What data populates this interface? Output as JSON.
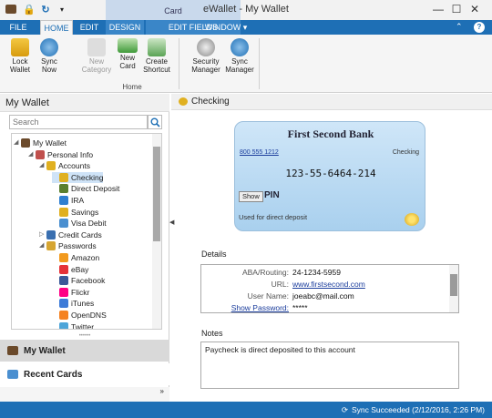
{
  "window": {
    "title": "eWallet - My Wallet",
    "context_group": "Card"
  },
  "ribbon": {
    "tabs": [
      "FILE",
      "HOME",
      "EDIT",
      "DESIGN",
      "EDIT FIELDS",
      "WINDOW"
    ],
    "home_group": "Home",
    "buttons": [
      {
        "label": "Lock Wallet",
        "icon": "lock-icon"
      },
      {
        "label": "Sync Now",
        "icon": "sync-icon"
      },
      {
        "label": "New Category",
        "icon": "folder-icon"
      },
      {
        "label": "New Card",
        "icon": "card-icon"
      },
      {
        "label": "Create Shortcut",
        "icon": "shortcut-icon"
      },
      {
        "label": "Security Manager",
        "icon": "security-icon"
      },
      {
        "label": "Sync Manager",
        "icon": "sync-manager-icon"
      }
    ]
  },
  "left_pane": {
    "title": "My Wallet",
    "search_placeholder": "Search",
    "tree": [
      {
        "label": "My Wallet",
        "icon": "wallet-icon",
        "expander": "◢"
      },
      {
        "label": "Personal Info",
        "icon": "person-icon",
        "expander": "◢"
      },
      {
        "label": "Accounts",
        "icon": "coins-icon",
        "expander": "◢"
      },
      {
        "label": "Checking",
        "icon": "coins-icon",
        "expander": ""
      },
      {
        "label": "Direct Deposit",
        "icon": "deposit-icon",
        "expander": ""
      },
      {
        "label": "IRA",
        "icon": "info-icon",
        "expander": ""
      },
      {
        "label": "Savings",
        "icon": "coins-icon",
        "expander": ""
      },
      {
        "label": "Visa Debit",
        "icon": "card-icon",
        "expander": ""
      },
      {
        "label": "Credit Cards",
        "icon": "credit-card-icon",
        "expander": "▷"
      },
      {
        "label": "Passwords",
        "icon": "key-icon",
        "expander": "◢"
      },
      {
        "label": "Amazon",
        "icon": "amazon-icon",
        "expander": ""
      },
      {
        "label": "eBay",
        "icon": "ebay-icon",
        "expander": ""
      },
      {
        "label": "Facebook",
        "icon": "facebook-icon",
        "expander": ""
      },
      {
        "label": "Flickr",
        "icon": "flickr-icon",
        "expander": ""
      },
      {
        "label": "iTunes",
        "icon": "itunes-icon",
        "expander": ""
      },
      {
        "label": "OpenDNS",
        "icon": "opendns-icon",
        "expander": ""
      },
      {
        "label": "Twitter",
        "icon": "twitter-icon",
        "expander": ""
      }
    ],
    "nav_buttons": [
      "My Wallet",
      "Recent Cards"
    ]
  },
  "right_pane": {
    "title": "Checking",
    "card": {
      "bank": "First Second Bank",
      "phone": "800 555 1212",
      "type": "Checking",
      "number": "123-55-6464-214",
      "show_button": "Show",
      "pin_label": "PIN",
      "note": "Used for direct deposit"
    },
    "details_label": "Details",
    "details": [
      {
        "label": "ABA/Routing:",
        "value": "24-1234-5959",
        "label_link": false,
        "value_link": false
      },
      {
        "label": "URL:",
        "value": "www.firstsecond.com",
        "label_link": false,
        "value_link": true
      },
      {
        "label": "User Name:",
        "value": "joeabc@mail.com",
        "label_link": false,
        "value_link": false
      },
      {
        "label": "Show Password:",
        "value": "*****",
        "label_link": true,
        "value_link": false
      }
    ],
    "notes_label": "Notes",
    "notes": "Paycheck is direct deposited to this account"
  },
  "status": "Sync Succeeded (2/12/2016, 2:26 PM)"
}
